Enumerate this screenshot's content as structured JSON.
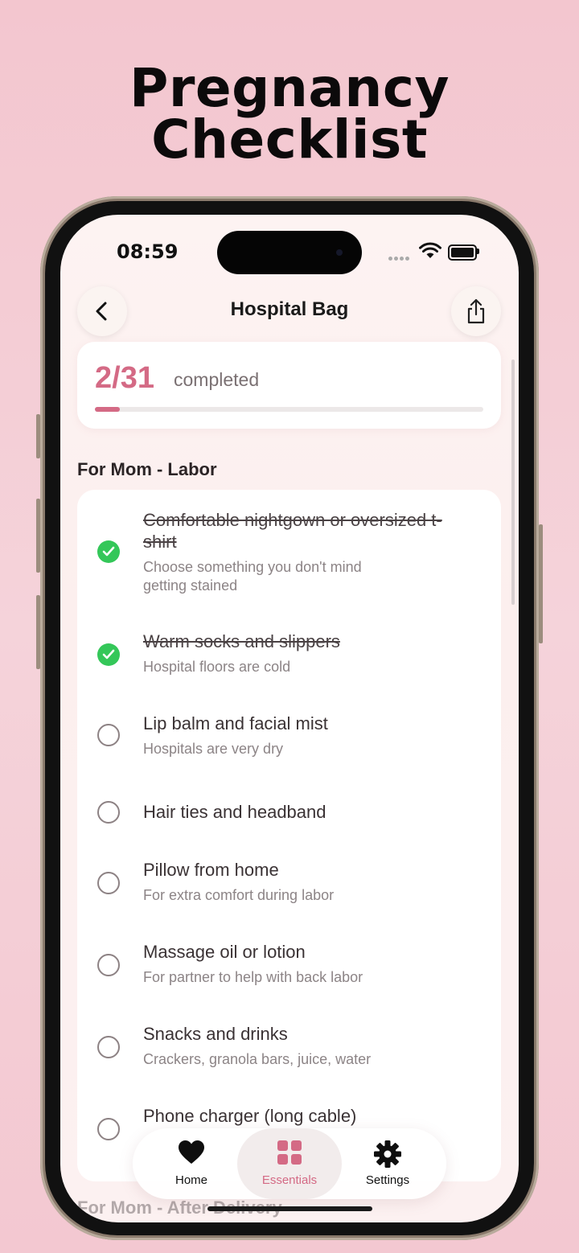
{
  "headline": {
    "line1": "Pregnancy",
    "line2": "Checklist"
  },
  "status_bar": {
    "time": "08:59"
  },
  "nav": {
    "title": "Hospital Bag",
    "back_icon": "chevron-left-icon",
    "share_icon": "share-icon"
  },
  "progress": {
    "count": "2/31",
    "label": "completed",
    "fraction": 0.065
  },
  "section": {
    "title": "For Mom - Labor"
  },
  "items": [
    {
      "title": "Comfortable nightgown or oversized t-shirt",
      "subtitle": "Choose something you don't mind getting stained",
      "checked": true
    },
    {
      "title": "Warm socks and slippers",
      "subtitle": "Hospital floors are cold",
      "checked": true
    },
    {
      "title": "Lip balm and facial mist",
      "subtitle": "Hospitals are very dry",
      "checked": false
    },
    {
      "title": "Hair ties and headband",
      "subtitle": "",
      "checked": false
    },
    {
      "title": "Pillow from home",
      "subtitle": "For extra comfort during labor",
      "checked": false
    },
    {
      "title": "Massage oil or lotion",
      "subtitle": "For partner to help with back labor",
      "checked": false
    },
    {
      "title": "Snacks and drinks",
      "subtitle": "Crackers, granola bars, juice, water",
      "checked": false
    },
    {
      "title": "Phone charger (long cable)",
      "subtitle": "",
      "checked": false
    }
  ],
  "next_section": {
    "title": "For Mom - After Delivery"
  },
  "tabbar": {
    "tabs": [
      {
        "label": "Home",
        "icon": "heart-icon"
      },
      {
        "label": "Essentials",
        "icon": "grid-icon",
        "active": true
      },
      {
        "label": "Settings",
        "icon": "gear-icon"
      }
    ]
  },
  "colors": {
    "accent": "#d46a85",
    "check": "#34c759",
    "background": "#f3c6cf"
  }
}
